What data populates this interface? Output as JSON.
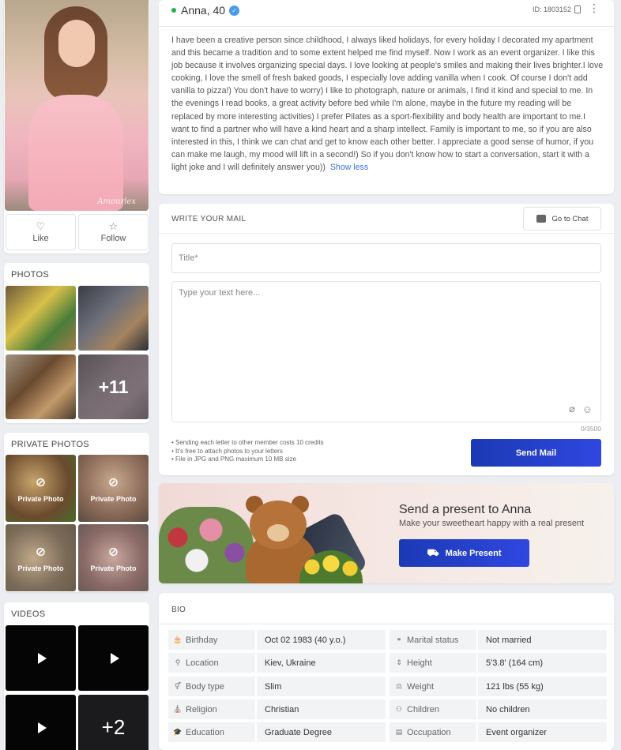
{
  "profile": {
    "name_age": "Anna, 40",
    "id_label": "ID: 1803152",
    "photo_watermark": "Amourlex",
    "like_label": "Like",
    "follow_label": "Follow",
    "about": "I have been a creative person since childhood, I always liked holidays, for every holiday I decorated my apartment and this became a tradition and to some extent helped me find myself. Now I work as an event organizer. I like this job because it involves organizing special days. I love looking at people's smiles and making their lives brighter.I love cooking, I love the smell of fresh baked goods, I especially love adding vanilla when I cook. Of course I don't add vanilla to pizza!) You don't have to worry) I like to photograph, nature or animals, I find it kind and special to me. In the evenings I read books, a great activity before bed while I'm alone, maybe in the future my reading will be replaced by more interesting activities) I prefer Pilates as a sport-flexibility and body health are important to me.I want to find a partner who will have a kind heart and a sharp intellect. Family is important to me, so if you are also interested in this, I think we can chat and get to know each other better. I appreciate a good sense of humor, if you can make me laugh, my mood will lift in a second!) So if you don't know how to start a conversation, start it with a light joke and I will definitely answer you))",
    "show_less": "Show less"
  },
  "photos": {
    "title": "PHOTOS",
    "more_count": "+11"
  },
  "private_photos": {
    "title": "PRIVATE PHOTOS",
    "items": [
      "Private Photo",
      "Private Photo",
      "Private Photo",
      "Private Photo"
    ]
  },
  "videos": {
    "title": "VIDEOS",
    "more_count": "+2"
  },
  "mail": {
    "title": "WRITE YOUR MAIL",
    "go_to_chat": "Go to Chat",
    "title_placeholder": "Title*",
    "text_placeholder": "Type your text here...",
    "counter": "0/3500",
    "notes": [
      "• Sending each letter to other member costs 10 credits",
      "• It's free to attach photos to your letters",
      "• File in JPG and PNG maximum 10 MB size"
    ],
    "send_label": "Send Mail"
  },
  "present": {
    "title": "Send a present to Anna",
    "subtitle": "Make your sweetheart happy with a real present",
    "button": "Make Present"
  },
  "bio": {
    "title": "BIO",
    "left": [
      {
        "label": "Birthday",
        "value": "Oct 02 1983 (40 y.o.)",
        "icon": "cake-icon"
      },
      {
        "label": "Location",
        "value": "Kiev, Ukraine",
        "icon": "location-pin-icon"
      },
      {
        "label": "Body type",
        "value": "Slim",
        "icon": "person-icon"
      },
      {
        "label": "Religion",
        "value": "Christian",
        "icon": "religion-icon"
      },
      {
        "label": "Education",
        "value": "Graduate Degree",
        "icon": "graduation-cap-icon"
      }
    ],
    "right": [
      {
        "label": "Marital status",
        "value": "Not married",
        "icon": "rings-icon"
      },
      {
        "label": "Height",
        "value": "5'3.8' (164 cm)",
        "icon": "height-icon"
      },
      {
        "label": "Weight",
        "value": "121 lbs (55 kg)",
        "icon": "scale-icon"
      },
      {
        "label": "Children",
        "value": "No children",
        "icon": "children-icon"
      },
      {
        "label": "Occupation",
        "value": "Event organizer",
        "icon": "briefcase-icon"
      }
    ]
  },
  "colors": {
    "accent": "#2f47e0",
    "online": "#2bb24c",
    "verified": "#4a9be8",
    "link": "#3b6fe0"
  }
}
